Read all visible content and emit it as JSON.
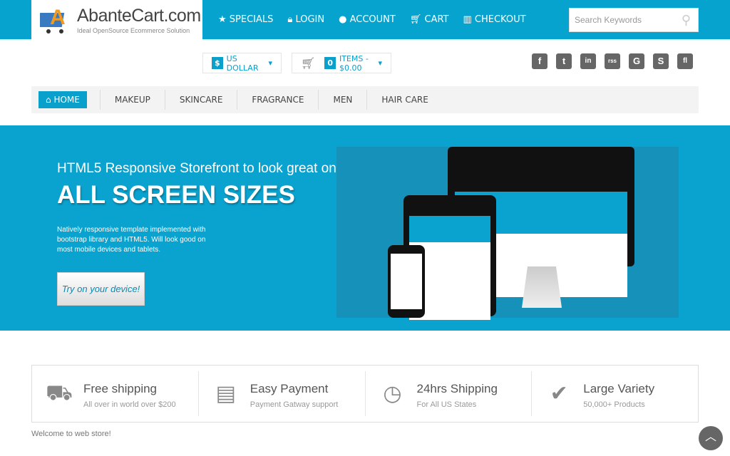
{
  "logo": {
    "name": "AbanteCart.com",
    "tagline": "Ideal OpenSource Ecommerce Solution"
  },
  "topnav": [
    "SPECIALS",
    "LOGIN",
    "ACCOUNT",
    "CART",
    "CHECKOUT"
  ],
  "topnav_icons": [
    "star-icon",
    "lock-icon",
    "user-icon",
    "cart-icon",
    "barcode-icon"
  ],
  "search": {
    "placeholder": "Search Keywords"
  },
  "currency": {
    "symbol": "$",
    "label": "US DOLLAR"
  },
  "cart": {
    "count": "0",
    "label": "ITEMS - $0.00"
  },
  "social": [
    "f",
    "t",
    "in",
    "rss",
    "G",
    "S",
    "fl"
  ],
  "menu": {
    "home": "HOME",
    "items": [
      "MAKEUP",
      "SKINCARE",
      "FRAGRANCE",
      "MEN",
      "HAIR CARE"
    ]
  },
  "banner": {
    "line1": "HTML5 Responsive Storefront to look great on",
    "line2": "ALL SCREEN SIZES",
    "desc": "Natively responsive template implemented with bootstrap library and HTML5. Will look good on most mobile devices and tablets.",
    "button": "Try on your device!"
  },
  "features": [
    {
      "title": "Free shipping",
      "sub": "All over in world over $200",
      "icon": "truck-icon"
    },
    {
      "title": "Easy Payment",
      "sub": "Payment Gatway support",
      "icon": "credit-card-icon"
    },
    {
      "title": "24hrs Shipping",
      "sub": "For All US States",
      "icon": "clock-icon"
    },
    {
      "title": "Large Variety",
      "sub": "50,000+ Products",
      "icon": "check-icon"
    }
  ],
  "welcome": "Welcome to web store!",
  "colors": {
    "brand": "#05a3cd"
  }
}
